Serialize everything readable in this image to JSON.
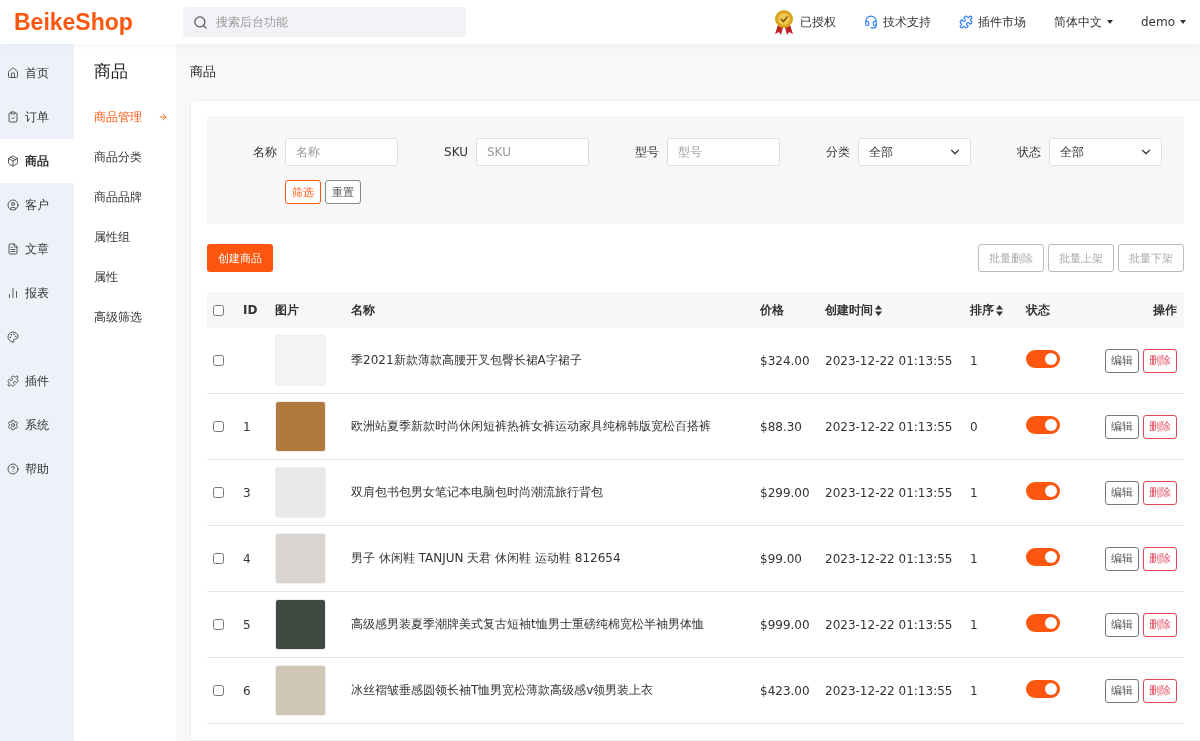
{
  "header": {
    "logo": "BeikeShop",
    "search": {
      "placeholder": "搜索后台功能"
    },
    "links": [
      {
        "kind": "badge",
        "label": "已授权"
      },
      {
        "kind": "support",
        "label": "技术支持"
      },
      {
        "kind": "plugin",
        "label": "插件市场"
      },
      {
        "kind": "dropdown",
        "label": "简体中文"
      },
      {
        "kind": "dropdown",
        "label": "demo"
      }
    ]
  },
  "sidebar": {
    "items": [
      {
        "label": "首页",
        "selected": false
      },
      {
        "label": "订单",
        "selected": false
      },
      {
        "label": "商品",
        "selected": true
      },
      {
        "label": "客户",
        "selected": false
      },
      {
        "label": "文章",
        "selected": false
      },
      {
        "label": "报表",
        "selected": false
      },
      {
        "selected": false
      },
      {
        "label": "插件",
        "selected": false
      },
      {
        "label": "系统",
        "selected": false
      },
      {
        "label": "帮助",
        "selected": false
      }
    ]
  },
  "submenu": {
    "title": "商品",
    "items": [
      {
        "label": "商品管理",
        "selected": true
      },
      {
        "label": "商品分类",
        "selected": false
      },
      {
        "label": "商品品牌",
        "selected": false
      },
      {
        "label": "属性组",
        "selected": false
      },
      {
        "label": "属性",
        "selected": false
      },
      {
        "label": "高级筛选",
        "selected": false
      }
    ]
  },
  "page_title": "商品",
  "filters": [
    {
      "kind": "input",
      "label": "名称",
      "placeholder": "名称"
    },
    {
      "kind": "input",
      "label": "SKU",
      "placeholder": "SKU"
    },
    {
      "kind": "input",
      "label": "型号",
      "placeholder": "型号"
    },
    {
      "kind": "select",
      "label": "分类",
      "value": "全部"
    },
    {
      "kind": "select",
      "label": "状态",
      "value": "全部"
    }
  ],
  "filter_buttons": [
    {
      "kind": "primary",
      "label": "筛选"
    },
    {
      "kind": "plain",
      "label": "重置"
    }
  ],
  "create_button": "创建商品",
  "bulk_buttons": [
    {
      "label": "批量删除",
      "disabled": true
    },
    {
      "label": "批量上架",
      "disabled": true
    },
    {
      "label": "批量下架",
      "disabled": true
    }
  ],
  "table": {
    "select_all": {
      "checked": false
    },
    "columns": [
      {
        "label": "ID",
        "sortable": false
      },
      {
        "label": "图片",
        "sortable": false
      },
      {
        "label": "名称",
        "sortable": false
      },
      {
        "label": "价格",
        "sortable": false
      },
      {
        "label": "创建时间",
        "sortable": true
      },
      {
        "label": "排序",
        "sortable": true
      },
      {
        "label": "状态",
        "sortable": false
      },
      {
        "label": "操作",
        "sortable": false
      }
    ],
    "rows": [
      {
        "checked": false,
        "name": "季2021新款薄款高腰开叉包臀长裙A字裙子",
        "price": "$324.00",
        "created": "2023-12-22 01:13:55",
        "sort": "1",
        "on": true,
        "color": "#f3f3f3",
        "actions": [
          {
            "kind": "edit",
            "label": "编辑"
          },
          {
            "kind": "delete",
            "label": "删除"
          }
        ]
      },
      {
        "checked": false,
        "id": "1",
        "name": "欧洲站夏季新款时尚休闲短裤热裤女裤运动家具纯棉韩版宽松百搭裤",
        "price": "$88.30",
        "created": "2023-12-22 01:13:55",
        "sort": "0",
        "on": true,
        "color": "#b07a3e",
        "actions": [
          {
            "kind": "edit",
            "label": "编辑"
          },
          {
            "kind": "delete",
            "label": "删除"
          }
        ]
      },
      {
        "checked": false,
        "id": "3",
        "name": "双肩包书包男女笔记本电脑包时尚潮流旅行背包",
        "price": "$299.00",
        "created": "2023-12-22 01:13:55",
        "sort": "1",
        "on": true,
        "color": "#e8e8e8",
        "actions": [
          {
            "kind": "edit",
            "label": "编辑"
          },
          {
            "kind": "delete",
            "label": "删除"
          }
        ]
      },
      {
        "checked": false,
        "id": "4",
        "name": "男子 休闲鞋 TANJUN 天君 休闲鞋 运动鞋 812654",
        "price": "$99.00",
        "created": "2023-12-22 01:13:55",
        "sort": "1",
        "on": true,
        "color": "#d9d4d0",
        "actions": [
          {
            "kind": "edit",
            "label": "编辑"
          },
          {
            "kind": "delete",
            "label": "删除"
          }
        ]
      },
      {
        "checked": false,
        "id": "5",
        "name": "高级感男装夏季潮牌美式复古短袖t恤男士重磅纯棉宽松半袖男体恤",
        "price": "$999.00",
        "created": "2023-12-22 01:13:55",
        "sort": "1",
        "on": true,
        "color": "#3c4a42",
        "actions": [
          {
            "kind": "edit",
            "label": "编辑"
          },
          {
            "kind": "delete",
            "label": "删除"
          }
        ]
      },
      {
        "checked": false,
        "id": "6",
        "name": "冰丝褶皱垂感圆领长袖T恤男宽松薄款高级感v领男装上衣",
        "price": "$423.00",
        "created": "2023-12-22 01:13:55",
        "sort": "1",
        "on": true,
        "color": "#cfc6b5",
        "actions": [
          {
            "kind": "edit",
            "label": "编辑"
          },
          {
            "kind": "delete",
            "label": "删除"
          }
        ]
      }
    ]
  }
}
